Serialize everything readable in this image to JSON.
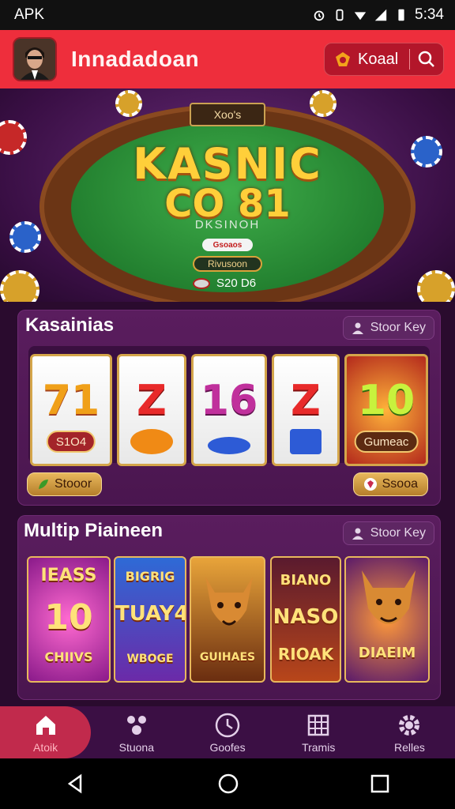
{
  "status_bar": {
    "label": "APK",
    "time": "5:34",
    "icons": [
      "alarm-icon",
      "vibrate-icon",
      "wifi-icon",
      "signal-icon",
      "battery-icon"
    ]
  },
  "header": {
    "title": "Innadadoan",
    "pill_label": "Koaal",
    "icons": [
      "avatar",
      "chip-icon",
      "search-icon"
    ]
  },
  "hero": {
    "badge": "Xoo's",
    "title_line1": "KASNIC",
    "title_line2": "CO 81",
    "subtitle": "DKSINOH",
    "chip_label": "Gsoaos",
    "plate": "Rivusoon",
    "amount": "S20 D6"
  },
  "section1": {
    "title": "Kasainias",
    "tag_label": "Stoor Key",
    "reels": [
      {
        "number": "71",
        "plate": "S1O4"
      },
      {
        "number": "Z",
        "plate": ""
      },
      {
        "number": "16",
        "plate": ""
      },
      {
        "number": "Z",
        "plate": ""
      },
      {
        "number": "10",
        "plate": "Gumeac"
      }
    ],
    "left_button": "Stooor",
    "right_button": "Ssooa"
  },
  "section2": {
    "title": "Multip Piaineen",
    "tag_label": "Stoor Key",
    "cards": [
      {
        "line1": "IEASS",
        "line2": "10",
        "line3": "CHIIVS"
      },
      {
        "line1": "BIGRIG",
        "line2": "TUAY4",
        "line3": "WBOGE"
      },
      {
        "line1": "",
        "line2": "",
        "line3": "GUIHAES"
      },
      {
        "line1": "BIANO",
        "line2": "NASO",
        "line3": "RIOAK"
      },
      {
        "line1": "",
        "line2": "",
        "line3": "DIAEIM"
      }
    ]
  },
  "bottom_nav": {
    "items": [
      {
        "label": "Atoik",
        "icon": "home-icon"
      },
      {
        "label": "Stuona",
        "icon": "team-icon"
      },
      {
        "label": "Goofes",
        "icon": "clock-icon"
      },
      {
        "label": "Tramis",
        "icon": "grid-icon"
      },
      {
        "label": "Relles",
        "icon": "gear-icon"
      }
    ]
  },
  "colors": {
    "header": "#ee2e3c",
    "background": "#2a0b2e",
    "panel": "#5a1d5e",
    "gold": "#e8b85c",
    "nav_active": "#c12a4c"
  }
}
